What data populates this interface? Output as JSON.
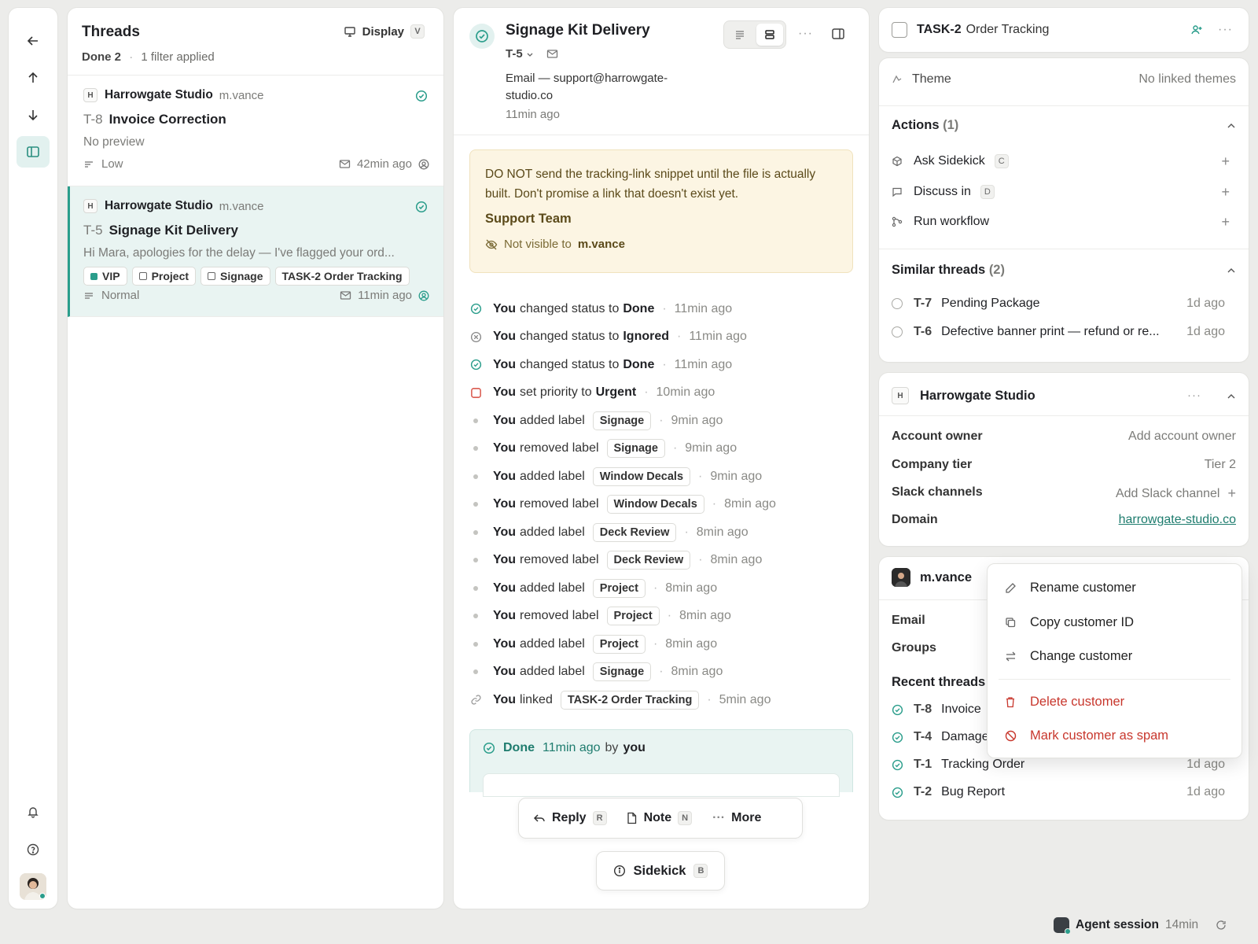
{
  "rail": {
    "icons": [
      "arrow-left-icon",
      "arrow-up-icon",
      "arrow-down-icon",
      "sidebar-icon",
      "bell-icon",
      "help-icon"
    ]
  },
  "threads": {
    "title": "Threads",
    "display_label": "Display",
    "display_key": "V",
    "filter_status": "Done 2",
    "filter_note": "1 filter applied",
    "items": [
      {
        "initial": "H",
        "customer": "Harrowgate Studio",
        "user": "m.vance",
        "id": "T-8",
        "subject": "Invoice Correction",
        "preview": "No preview",
        "priority": "Low",
        "time": "42min ago",
        "labels": []
      },
      {
        "initial": "H",
        "customer": "Harrowgate Studio",
        "user": "m.vance",
        "id": "T-5",
        "subject": "Signage Kit Delivery",
        "preview": "Hi Mara, apologies for the delay — I've flagged your ord...",
        "priority": "Normal",
        "time": "11min ago",
        "labels": [
          "VIP",
          "Project",
          "Signage",
          "TASK-2 Order Tracking"
        ]
      }
    ]
  },
  "conversation": {
    "title": "Signage Kit Delivery",
    "id": "T-5",
    "channel": "Email — support@harrowgate-studio.co",
    "time": "11min ago",
    "note": {
      "body": "DO NOT send the tracking-link snippet until the file is actually built. Don't promise a link that doesn't exist yet.",
      "team": "Support Team",
      "visibility_prefix": "Not visible to",
      "visibility_user": "m.vance"
    },
    "events": [
      {
        "icon": "check",
        "actor": "You",
        "text": "changed status to",
        "value": "Done",
        "label": "",
        "time": "11min ago"
      },
      {
        "icon": "x",
        "actor": "You",
        "text": "changed status to",
        "value": "Ignored",
        "label": "",
        "time": "11min ago"
      },
      {
        "icon": "check",
        "actor": "You",
        "text": "changed status to",
        "value": "Done",
        "label": "",
        "time": "11min ago"
      },
      {
        "icon": "urgent",
        "actor": "You",
        "text": "set priority to",
        "value": "Urgent",
        "label": "",
        "time": "10min ago"
      },
      {
        "icon": "dot",
        "actor": "You",
        "text": "added label",
        "value": "",
        "label": "Signage",
        "time": "9min ago"
      },
      {
        "icon": "dot",
        "actor": "You",
        "text": "removed label",
        "value": "",
        "label": "Signage",
        "time": "9min ago"
      },
      {
        "icon": "dot",
        "actor": "You",
        "text": "added label",
        "value": "",
        "label": "Window Decals",
        "time": "9min ago"
      },
      {
        "icon": "dot",
        "actor": "You",
        "text": "removed label",
        "value": "",
        "label": "Window Decals",
        "time": "8min ago"
      },
      {
        "icon": "dot",
        "actor": "You",
        "text": "added label",
        "value": "",
        "label": "Deck Review",
        "time": "8min ago"
      },
      {
        "icon": "dot",
        "actor": "You",
        "text": "removed label",
        "value": "",
        "label": "Deck Review",
        "time": "8min ago"
      },
      {
        "icon": "dot",
        "actor": "You",
        "text": "added label",
        "value": "",
        "label": "Project",
        "time": "8min ago"
      },
      {
        "icon": "dot",
        "actor": "You",
        "text": "removed label",
        "value": "",
        "label": "Project",
        "time": "8min ago"
      },
      {
        "icon": "dot",
        "actor": "You",
        "text": "added label",
        "value": "",
        "label": "Project",
        "time": "8min ago"
      },
      {
        "icon": "dot",
        "actor": "You",
        "text": "added label",
        "value": "",
        "label": "Signage",
        "time": "8min ago"
      },
      {
        "icon": "link",
        "actor": "You",
        "text": "linked",
        "value": "",
        "label": "TASK-2 Order Tracking",
        "time": "5min ago"
      }
    ],
    "done": {
      "status": "Done",
      "time": "11min ago",
      "by": "by",
      "actor": "you"
    },
    "composer": {
      "reply": "Reply",
      "reply_key": "R",
      "note": "Note",
      "note_key": "N",
      "more": "More",
      "sidekick": "Sidekick",
      "sidekick_key": "B"
    }
  },
  "task": {
    "id": "TASK-2",
    "title": "Order Tracking"
  },
  "details": {
    "theme_label": "Theme",
    "theme_value": "No linked themes",
    "actions_title": "Actions",
    "actions_count": "(1)",
    "actions": [
      {
        "label": "Ask Sidekick",
        "key": "C"
      },
      {
        "label": "Discuss in",
        "key": "D"
      },
      {
        "label": "Run workflow",
        "key": ""
      }
    ],
    "similar_title": "Similar threads",
    "similar_count": "(2)",
    "similar": [
      {
        "id": "T-7",
        "title": "Pending Package",
        "time": "1d ago"
      },
      {
        "id": "T-6",
        "title": "Defective banner print — refund or re...",
        "time": "1d ago"
      }
    ]
  },
  "company": {
    "initial": "H",
    "name": "Harrowgate Studio",
    "fields": [
      {
        "k": "Account owner",
        "v": "Add account owner"
      },
      {
        "k": "Company tier",
        "v": "Tier 2"
      },
      {
        "k": "Slack channels",
        "v": "Add Slack channel"
      },
      {
        "k": "Domain",
        "v": "harrowgate-studio.co"
      }
    ]
  },
  "person": {
    "name": "m.vance",
    "email_label": "Email",
    "groups_label": "Groups",
    "recent_title": "Recent threads",
    "recent": [
      {
        "id": "T-8",
        "title": "Invoice",
        "time": ""
      },
      {
        "id": "T-4",
        "title": "Damage",
        "time": ""
      },
      {
        "id": "T-1",
        "title": "Tracking Order",
        "time": "1d ago"
      },
      {
        "id": "T-2",
        "title": "Bug Report",
        "time": "1d ago"
      }
    ]
  },
  "menu": {
    "items": [
      {
        "label": "Rename customer",
        "danger": false
      },
      {
        "label": "Copy customer ID",
        "danger": false
      },
      {
        "label": "Change customer",
        "danger": false
      },
      {
        "label": "Delete customer",
        "danger": true
      },
      {
        "label": "Mark customer as spam",
        "danger": true
      }
    ]
  },
  "footer": {
    "label": "Agent session",
    "time": "14min"
  },
  "colors": {
    "accent": "#2a9d8b",
    "danger": "#c8372d",
    "note_bg": "#fcf5e3"
  }
}
